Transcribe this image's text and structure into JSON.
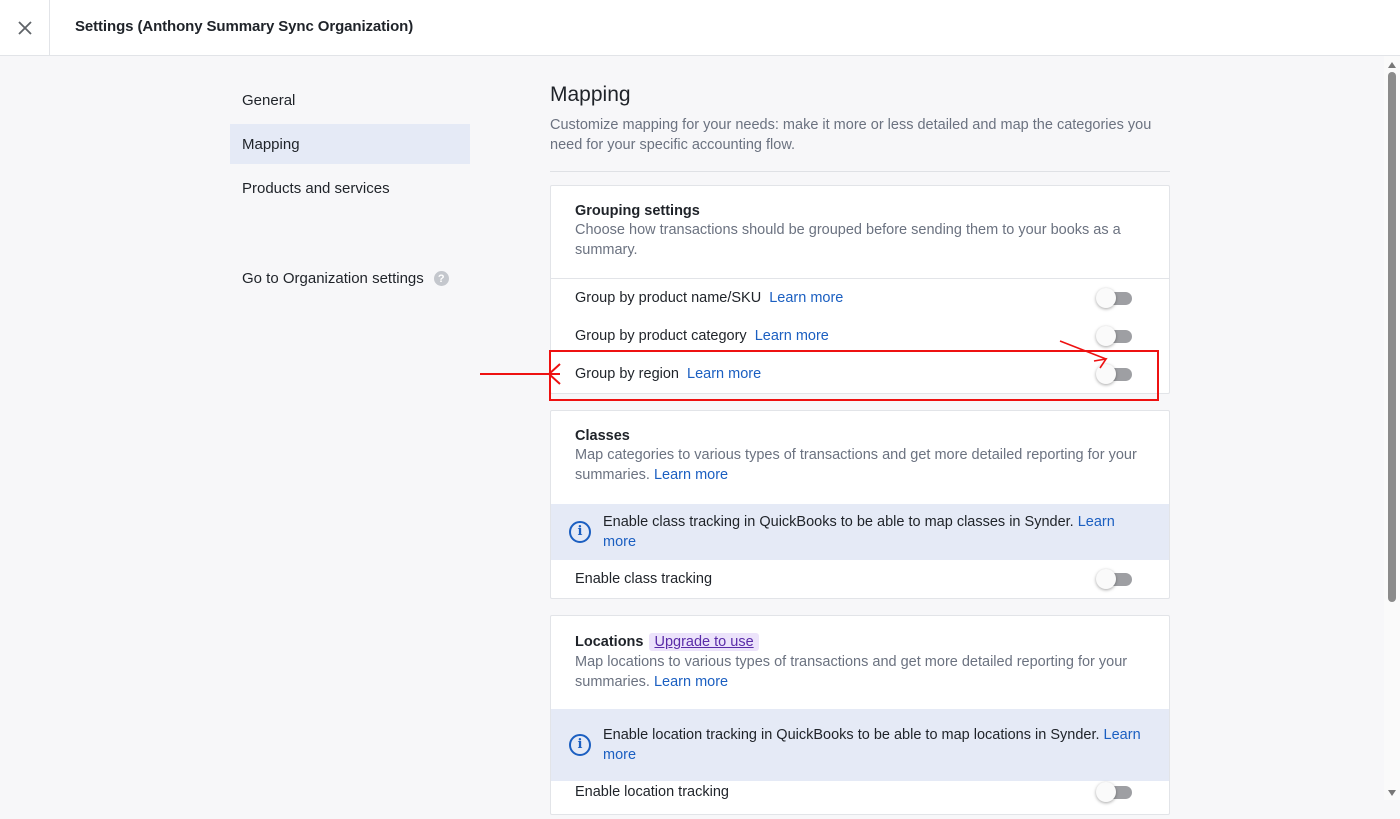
{
  "header": {
    "title": "Settings (Anthony Summary Sync Organization)",
    "close_icon": "close-icon"
  },
  "nav": {
    "items": [
      {
        "label": "General",
        "active": false
      },
      {
        "label": "Mapping",
        "active": true
      },
      {
        "label": "Products and services",
        "active": false
      }
    ],
    "org_settings_label": "Go to Organization settings",
    "help_glyph": "?"
  },
  "page": {
    "title": "Mapping",
    "description": "Customize mapping for your needs: make it more or less detailed and map the categories you need for your specific accounting flow."
  },
  "grouping": {
    "title": "Grouping settings",
    "description": "Choose how transactions should be grouped before sending them to your books as a summary.",
    "rows": [
      {
        "label": "Group by product name/SKU",
        "link": "Learn more",
        "enabled": false
      },
      {
        "label": "Group by product category",
        "link": "Learn more",
        "enabled": false
      },
      {
        "label": "Group by region",
        "link": "Learn more",
        "enabled": false
      }
    ]
  },
  "classes": {
    "title": "Classes",
    "description": "Map categories to various types of transactions and get more detailed reporting for your summaries.",
    "description_link": "Learn more",
    "info_text": "Enable class tracking in QuickBooks to be able to map classes in Synder.",
    "info_link": "Learn more",
    "toggle_label": "Enable class tracking",
    "enabled": false
  },
  "locations": {
    "title": "Locations",
    "badge": "Upgrade to use",
    "description": "Map locations to various types of transactions and get more detailed reporting for your summaries.",
    "description_link": "Learn more",
    "info_text": "Enable location tracking in QuickBooks to be able to map locations in Synder.",
    "info_link": "Learn more",
    "toggle_label": "Enable location tracking",
    "enabled": false
  },
  "colors": {
    "accent": "#1b5fc1",
    "nav_active_bg": "#e5eaf6",
    "info_bg": "#e5eaf6",
    "annotation": "#ee1111",
    "badge_bg": "#ece3fb"
  }
}
